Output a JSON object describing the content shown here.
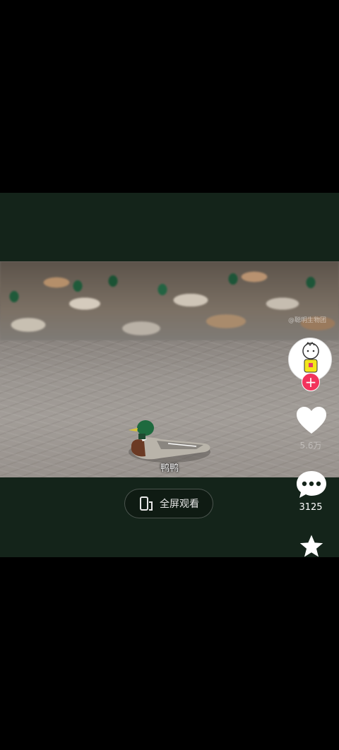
{
  "video": {
    "subtitle": "鸭鸭",
    "watermark": "@聪明生物团"
  },
  "controls": {
    "fullscreen_label": "全屏观看",
    "fullscreen_icon": "fullscreen-phone-icon"
  },
  "sidebar": {
    "avatar_icon": "cartoon-avatar",
    "follow_symbol": "+",
    "like_count": "5.6万",
    "comment_count": "3125",
    "icons": [
      "heart-icon",
      "comment-icon",
      "star-icon"
    ]
  },
  "colors": {
    "frame_background": "#14241a",
    "follow_red": "#f2335c",
    "icon_white": "#ffffff"
  }
}
